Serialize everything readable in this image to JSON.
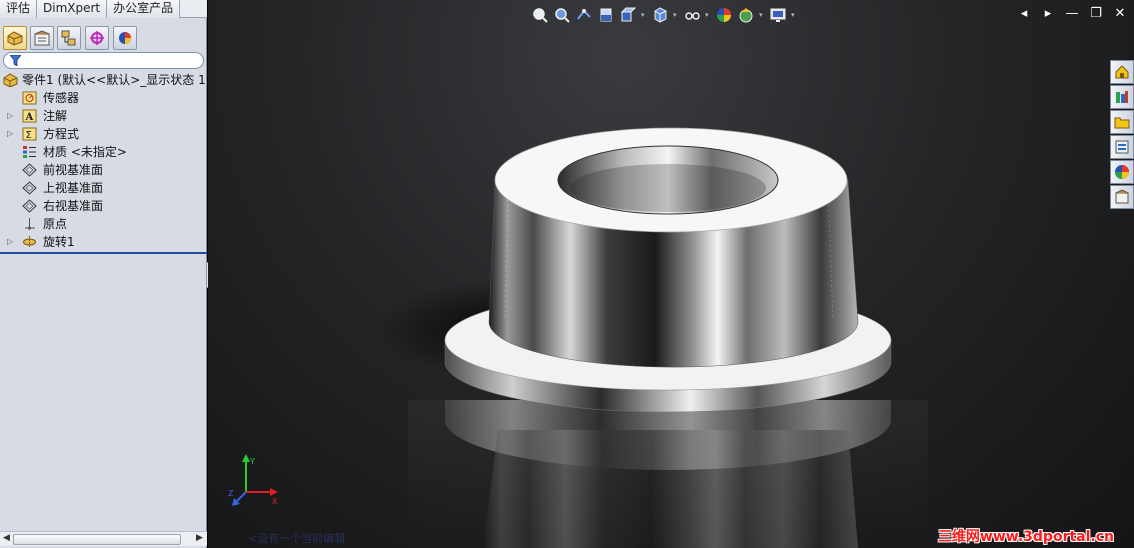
{
  "command_tabs": [
    "评估",
    "DimXpert",
    "办公室产品"
  ],
  "feature_manager": {
    "tabs": [
      {
        "icon": "feature-tree-icon"
      },
      {
        "icon": "property-manager-icon"
      },
      {
        "icon": "configuration-manager-icon"
      },
      {
        "icon": "dimxpert-manager-icon"
      },
      {
        "icon": "display-manager-icon"
      }
    ],
    "expand_label": "»",
    "tree": {
      "root": "零件1   (默认<<默认>_显示状态 1",
      "items": [
        "传感器",
        "注解",
        "方程式",
        "材质 <未指定>",
        "前视基准面",
        "上视基准面",
        "右视基准面",
        "原点",
        "旋转1"
      ]
    }
  },
  "viewport": {
    "status_text": "<没有一个当前编辑",
    "triad_labels": {
      "x": "X",
      "y": "Y",
      "z": "Z"
    },
    "watermark": "三维网www.3dportal.cn"
  },
  "window_controls": [
    "◂",
    "▸",
    "—",
    "❐",
    "✕"
  ],
  "colors": {
    "panel_bg": "#d6dbe4",
    "selection_rule": "#1f4f9a",
    "watermark": "#ff1a1a"
  }
}
